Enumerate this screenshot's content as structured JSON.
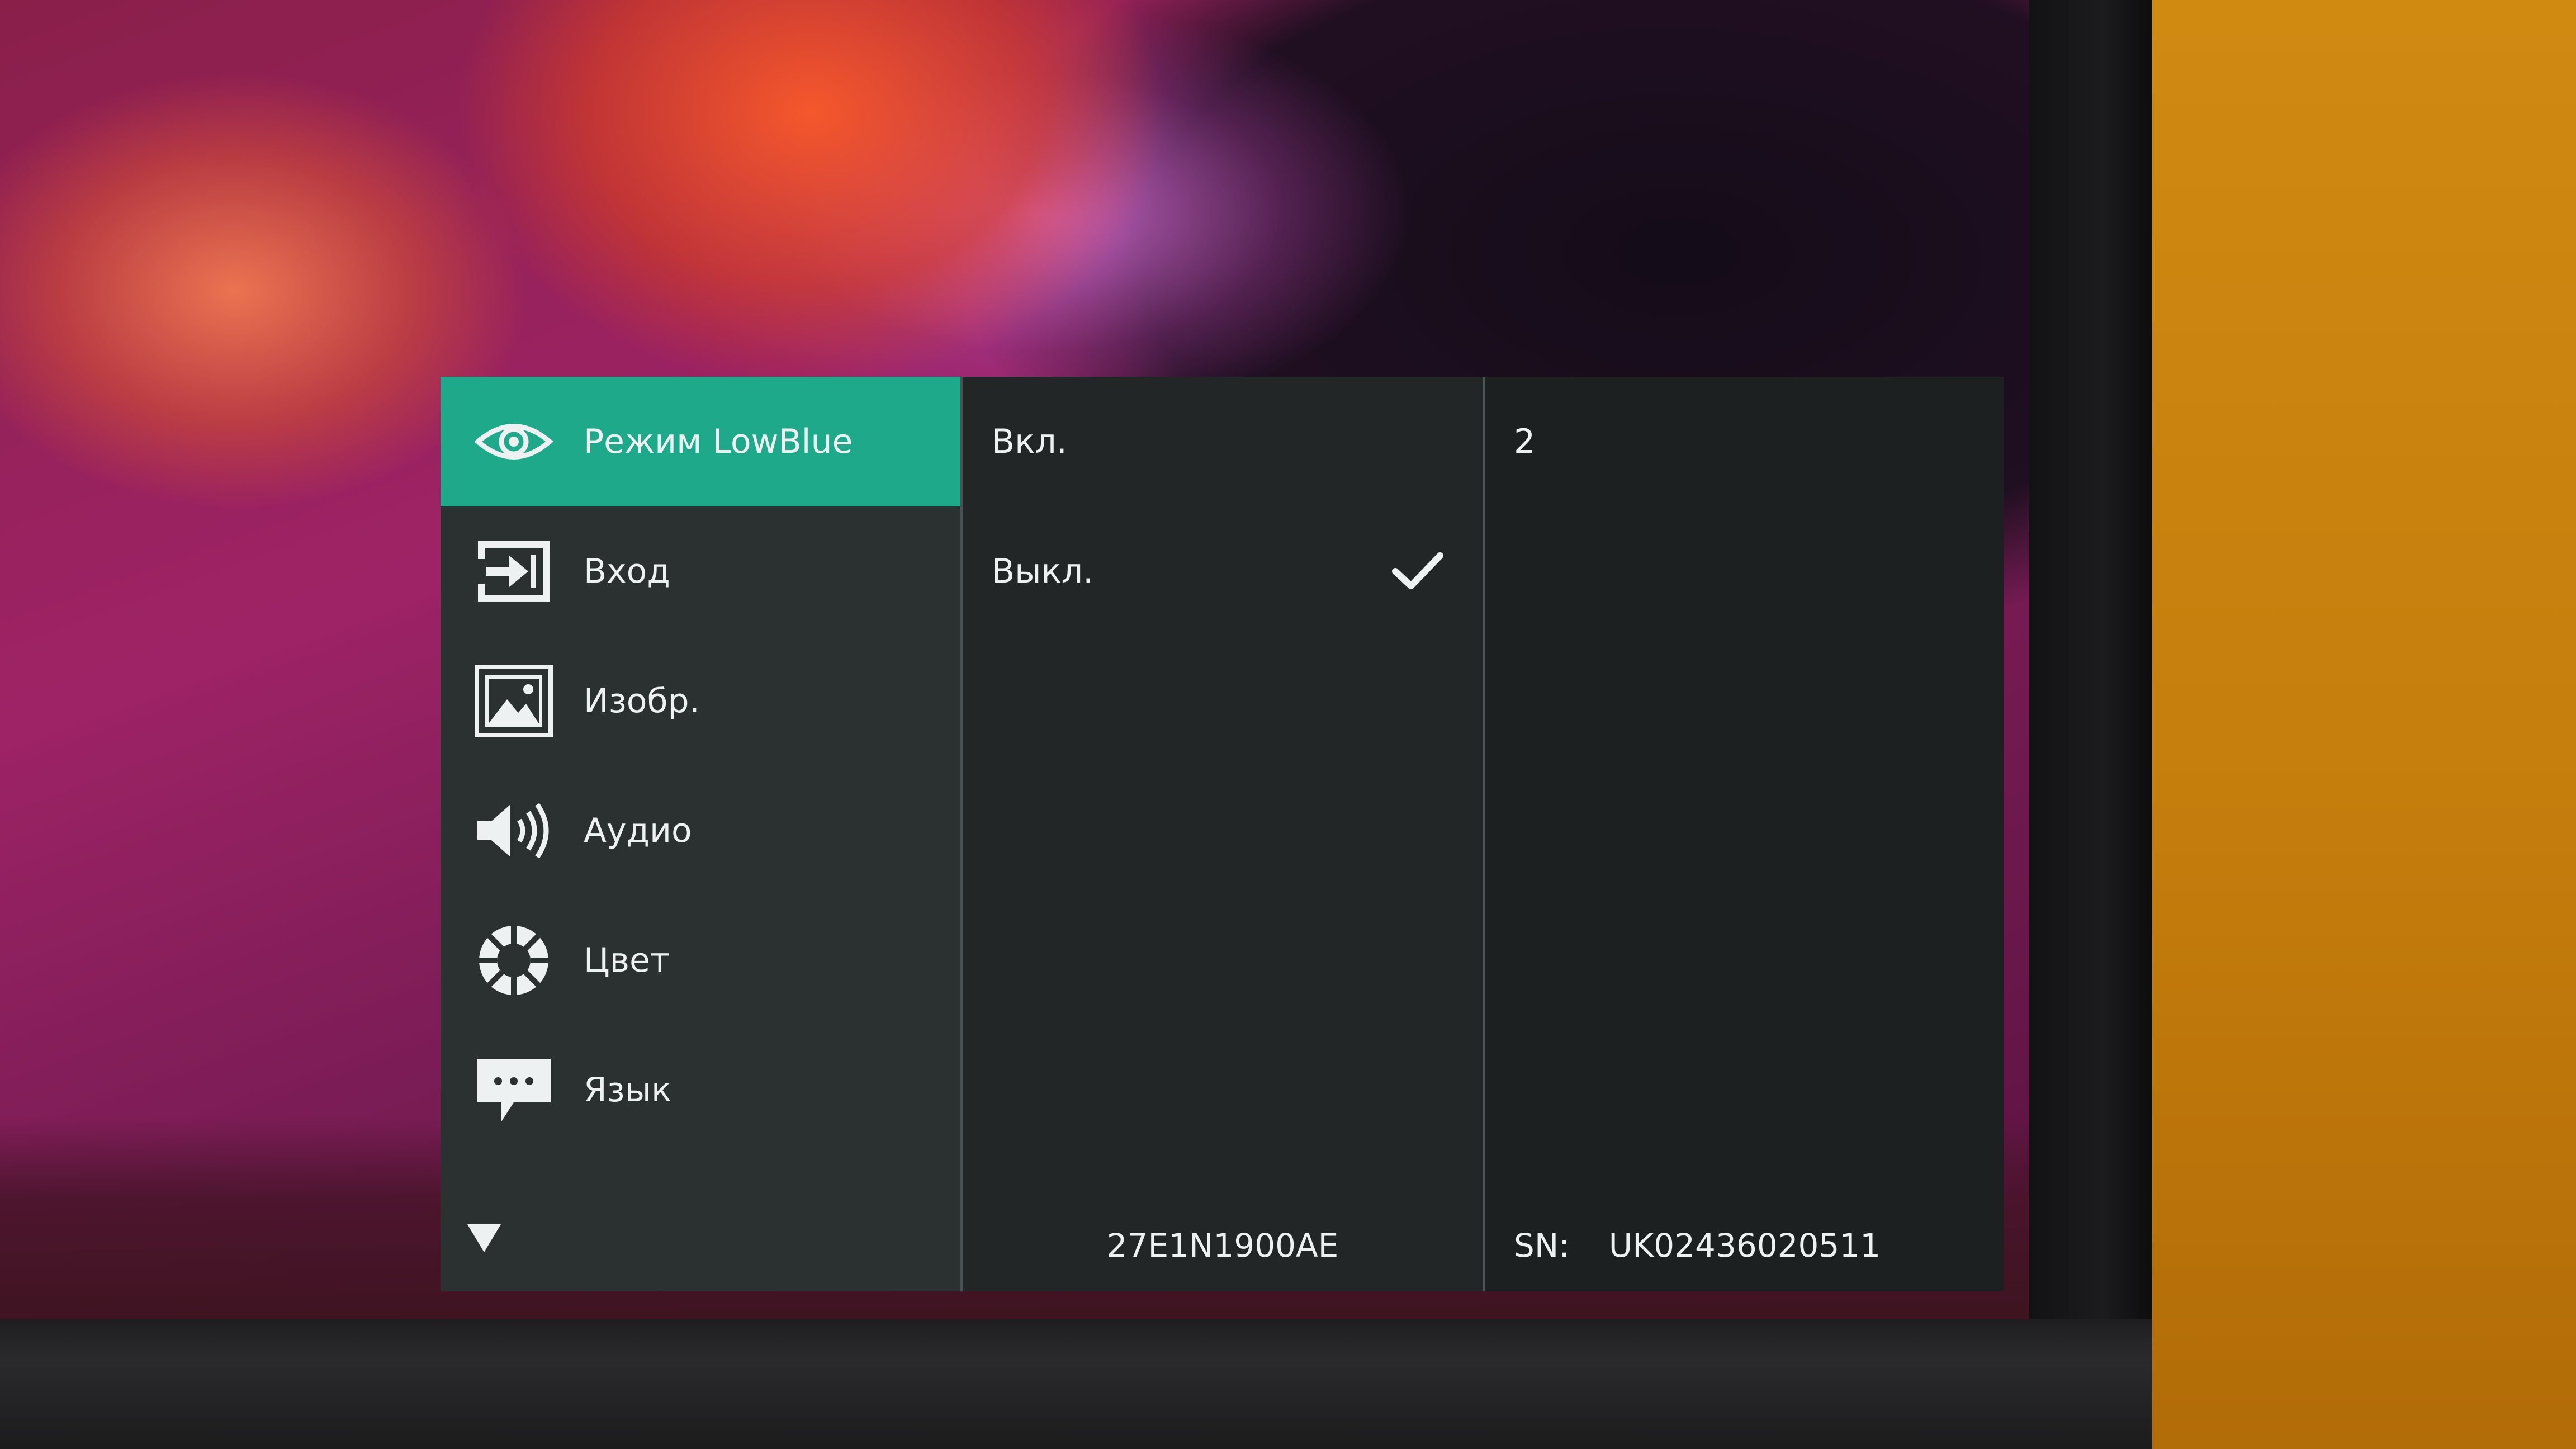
{
  "colors": {
    "accent": "#1ea98a",
    "panel_left": "#2b3031",
    "panel_mid": "#232627",
    "panel_right": "#1d2021",
    "text": "#eef1f1"
  },
  "menu": {
    "items": [
      {
        "label": "Режим LowBlue",
        "icon": "eye-icon",
        "selected": true
      },
      {
        "label": "Вход",
        "icon": "input-icon",
        "selected": false
      },
      {
        "label": "Изобр.",
        "icon": "picture-icon",
        "selected": false
      },
      {
        "label": "Аудио",
        "icon": "speaker-icon",
        "selected": false
      },
      {
        "label": "Цвет",
        "icon": "color-wheel-icon",
        "selected": false
      },
      {
        "label": "Язык",
        "icon": "speech-bubble-icon",
        "selected": false
      }
    ],
    "more_icon": "down-arrow-icon"
  },
  "options": {
    "items": [
      {
        "label": "Вкл.",
        "checked": false
      },
      {
        "label": "Выкл.",
        "checked": true
      }
    ],
    "model": "27E1N1900AE"
  },
  "value_panel": {
    "value": "2",
    "sn_label": "SN:",
    "sn_value": "UK02436020511"
  }
}
